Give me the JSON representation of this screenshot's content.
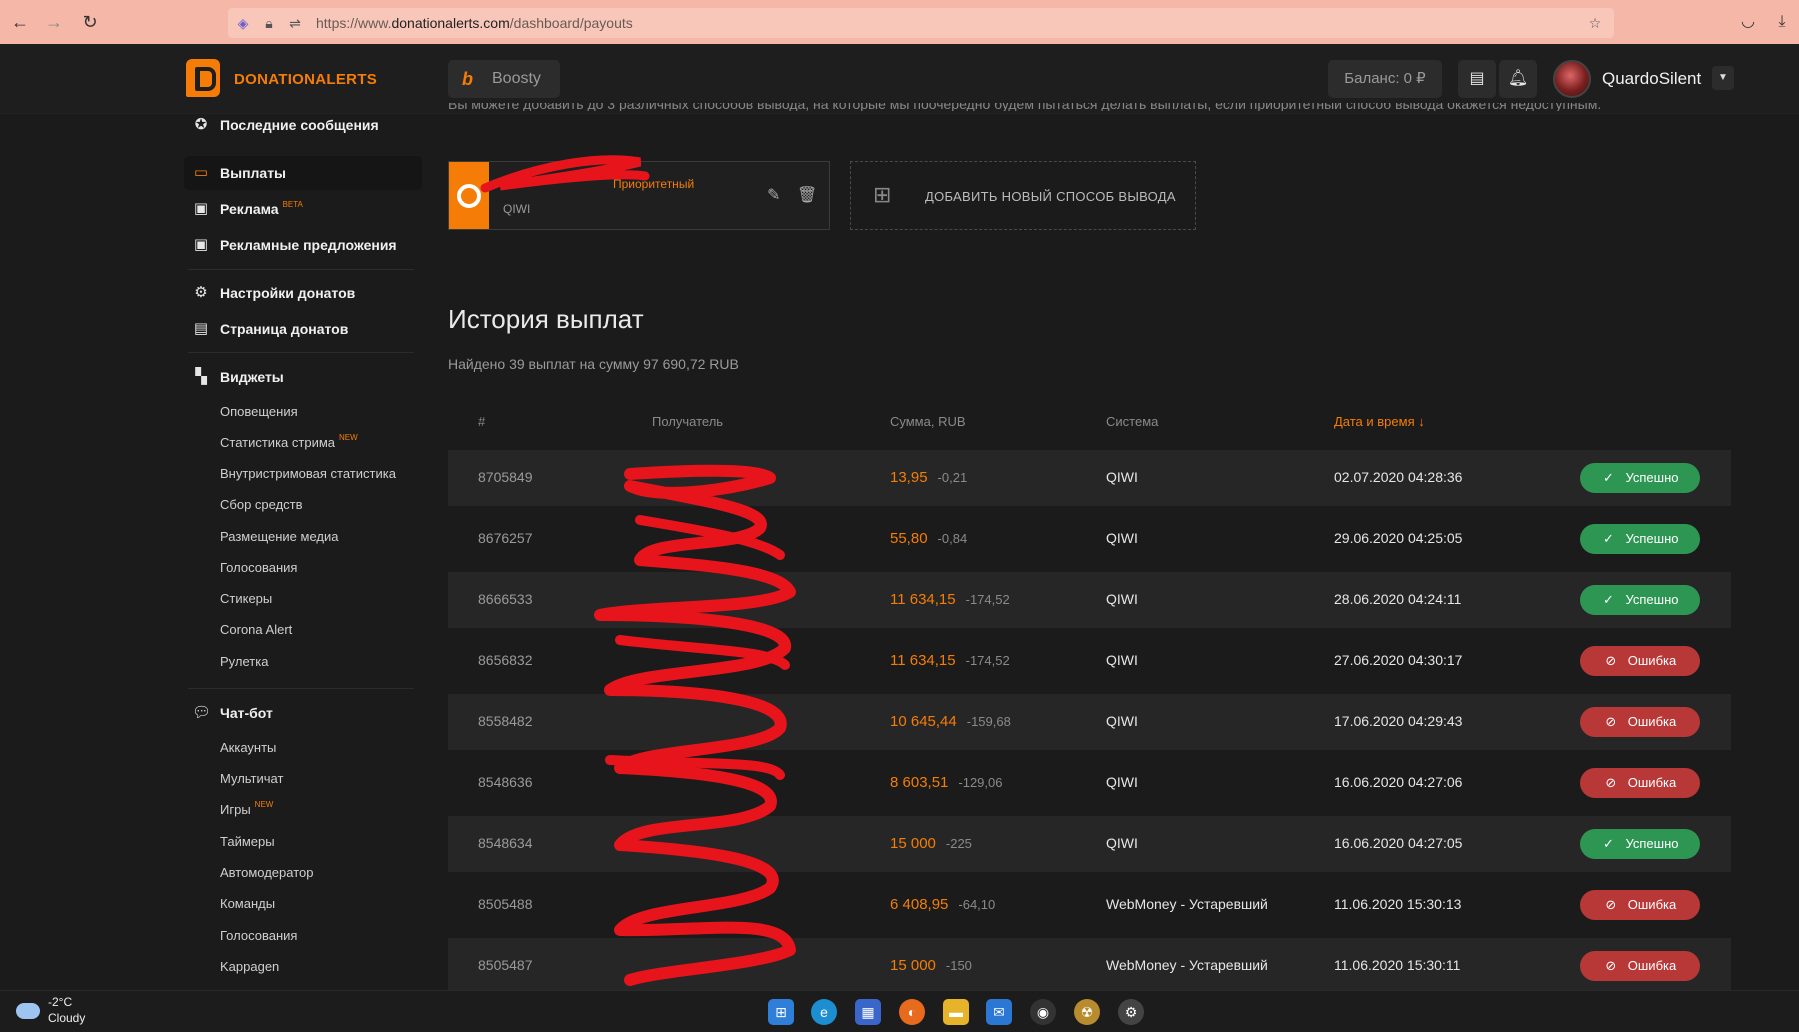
{
  "browser": {
    "url_prefix": "https://www.",
    "url_domain": "donationalerts.com",
    "url_path": "/dashboard/payouts"
  },
  "header": {
    "logo_text": "DONATIONALERTS",
    "boosty_label": "Boosty",
    "balance_label": "Баланс: 0 ₽",
    "username": "QuardoSilent"
  },
  "sidebar": {
    "items": [
      {
        "label": "Последние сообщения",
        "icon": "star-icon"
      },
      {
        "label": "Выплаты",
        "icon": "wallet-icon"
      },
      {
        "label": "Реклама",
        "badge": "BETA",
        "icon": "briefcase-icon"
      },
      {
        "label": "Рекламные предложения",
        "icon": "briefcase-icon"
      },
      {
        "label": "Настройки донатов",
        "icon": "gear-icon"
      },
      {
        "label": "Страница донатов",
        "icon": "page-icon"
      },
      {
        "label": "Виджеты",
        "icon": "widgets-icon"
      },
      {
        "label": "Чат-бот",
        "icon": "chat-icon"
      }
    ],
    "widgets_sub": [
      "Оповещения",
      "Статистика стрима",
      "Внутристримовая статистика",
      "Сбор средств",
      "Размещение медиа",
      "Голосования",
      "Стикеры",
      "Corona Alert",
      "Рулетка"
    ],
    "widgets_new_badge": "NEW",
    "chatbot_sub": [
      "Аккаунты",
      "Мультичат",
      "Игры",
      "Таймеры",
      "Автомодератор",
      "Команды",
      "Голосования",
      "Kappagen"
    ]
  },
  "main": {
    "top_hint": "Вы можете добавить до 3 различных способов вывода, на которые мы поочередно будем пытаться делать выплаты, если приоритетный способ вывода окажется недоступным.",
    "payout_method": {
      "priority_label": "Приоритетный",
      "system": "QIWI"
    },
    "add_method_label": "ДОБАВИТЬ НОВЫЙ СПОСОБ ВЫВОДА",
    "history_title": "История выплат",
    "history_summary": "Найдено 39 выплат на сумму 97 690,72 RUB",
    "columns": [
      "#",
      "Получатель",
      "Сумма, RUB",
      "Система",
      "Дата и время ↓"
    ],
    "rows": [
      {
        "id": "8705849",
        "amount": "13,95",
        "fee": "-0,21",
        "system": "QIWI",
        "date": "02.07.2020 04:28:36",
        "status": "Успешно",
        "ok": true
      },
      {
        "id": "8676257",
        "amount": "55,80",
        "fee": "-0,84",
        "system": "QIWI",
        "date": "29.06.2020 04:25:05",
        "status": "Успешно",
        "ok": true
      },
      {
        "id": "8666533",
        "amount": "11 634,15",
        "fee": "-174,52",
        "system": "QIWI",
        "date": "28.06.2020 04:24:11",
        "status": "Успешно",
        "ok": true
      },
      {
        "id": "8656832",
        "amount": "11 634,15",
        "fee": "-174,52",
        "system": "QIWI",
        "date": "27.06.2020 04:30:17",
        "status": "Ошибка",
        "ok": false
      },
      {
        "id": "8558482",
        "amount": "10 645,44",
        "fee": "-159,68",
        "system": "QIWI",
        "date": "17.06.2020 04:29:43",
        "status": "Ошибка",
        "ok": false
      },
      {
        "id": "8548636",
        "amount": "8 603,51",
        "fee": "-129,06",
        "system": "QIWI",
        "date": "16.06.2020 04:27:06",
        "status": "Ошибка",
        "ok": false
      },
      {
        "id": "8548634",
        "amount": "15 000",
        "fee": "-225",
        "system": "QIWI",
        "date": "16.06.2020 04:27:05",
        "status": "Успешно",
        "ok": true
      },
      {
        "id": "8505488",
        "amount": "6 408,95",
        "fee": "-64,10",
        "system": "WebMoney - Устаревший",
        "date": "11.06.2020 15:30:13",
        "status": "Ошибка",
        "ok": false
      },
      {
        "id": "8505487",
        "amount": "15 000",
        "fee": "-150",
        "system": "WebMoney - Устаревший",
        "date": "11.06.2020 15:30:11",
        "status": "Ошибка",
        "ok": false
      }
    ]
  },
  "taskbar": {
    "temperature": "-2°C",
    "condition": "Cloudy"
  },
  "colors": {
    "accent": "#f57d07",
    "success": "#2e9653",
    "error": "#b83737",
    "background": "#1b1b1b"
  }
}
